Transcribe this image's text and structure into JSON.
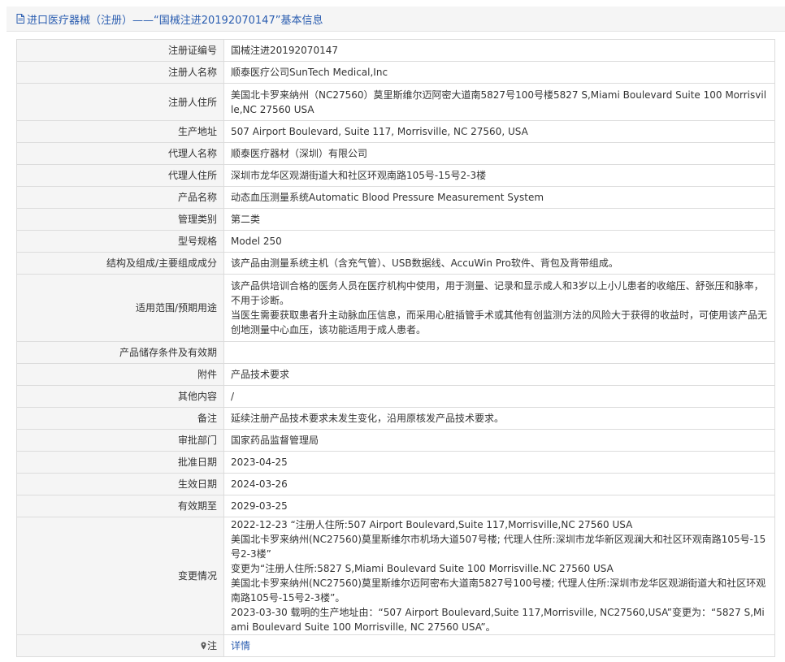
{
  "header": {
    "title": "进口医疗器械（注册）——“国械注进20192070147”基本信息"
  },
  "fields": [
    {
      "label": "注册证编号",
      "value": "国械注进20192070147"
    },
    {
      "label": "注册人名称",
      "value": "顺泰医疗公司SunTech Medical,Inc"
    },
    {
      "label": "注册人住所",
      "value": "美国北卡罗来纳州（NC27560）莫里斯维尔迈阿密大道南5827号100号楼5827 S,Miami Boulevard Suite 100 Morrisville,NC 27560 USA"
    },
    {
      "label": "生产地址",
      "value": "507 Airport Boulevard, Suite 117, Morrisville, NC 27560, USA"
    },
    {
      "label": "代理人名称",
      "value": "顺泰医疗器材（深圳）有限公司"
    },
    {
      "label": "代理人住所",
      "value": "深圳市龙华区观湖街道大和社区环观南路105号-15号2-3楼"
    },
    {
      "label": "产品名称",
      "value": "动态血压测量系统Automatic Blood Pressure Measurement System"
    },
    {
      "label": "管理类别",
      "value": "第二类"
    },
    {
      "label": "型号规格",
      "value": "Model 250"
    },
    {
      "label": "结构及组成/主要组成成分",
      "value": "该产品由测量系统主机（含充气管）、USB数据线、AccuWin Pro软件、背包及背带组成。"
    },
    {
      "label": "适用范围/预期用途",
      "value": "该产品供培训合格的医务人员在医疗机构中使用，用于测量、记录和显示成人和3岁以上小儿患者的收缩压、舒张压和脉率，不用于诊断。\n当医生需要获取患者升主动脉血压信息，而采用心脏插管手术或其他有创监测方法的风险大于获得的收益时，可使用该产品无创地测量中心血压，该功能适用于成人患者。"
    },
    {
      "label": "产品储存条件及有效期",
      "value": ""
    },
    {
      "label": "附件",
      "value": "产品技术要求"
    },
    {
      "label": "其他内容",
      "value": "/"
    },
    {
      "label": "备注",
      "value": "延续注册产品技术要求未发生变化，沿用原核发产品技术要求。"
    },
    {
      "label": "审批部门",
      "value": "国家药品监督管理局"
    },
    {
      "label": "批准日期",
      "value": "2023-04-25"
    },
    {
      "label": "生效日期",
      "value": "2024-03-26"
    },
    {
      "label": "有效期至",
      "value": "2029-03-25"
    },
    {
      "label": "变更情况",
      "value": "2022-12-23 “注册人住所:507 Airport Boulevard,Suite 117,Morrisville,NC 27560 USA\n美国北卡罗来纳州(NC27560)莫里斯维尔市机场大道507号楼; 代理人住所:深圳市龙华新区观澜大和社区环观南路105号-15号2-3楼”\n变更为“注册人住所:5827 S,Miami Boulevard Suite 100 Morrisville.NC 27560 USA\n美国北卡罗来纳州(NC27560)莫里斯维尔迈阿密布大道南5827号100号楼; 代理人住所:深圳市龙华区观湖街道大和社区环观南路105号-15号2-3楼”。\n2023-03-30 载明的生产地址由：“507 Airport Boulevard,Suite 117,Morrisville, NC27560,USA”变更为：“5827 S,Miami Boulevard Suite 100 Morrisville, NC 27560 USA”。"
    }
  ],
  "note": {
    "label": "注",
    "link": "详情"
  },
  "colors": {
    "accent": "#2a5db0",
    "label_bg": "#f5f5f5",
    "border": "#dcdcdc"
  }
}
